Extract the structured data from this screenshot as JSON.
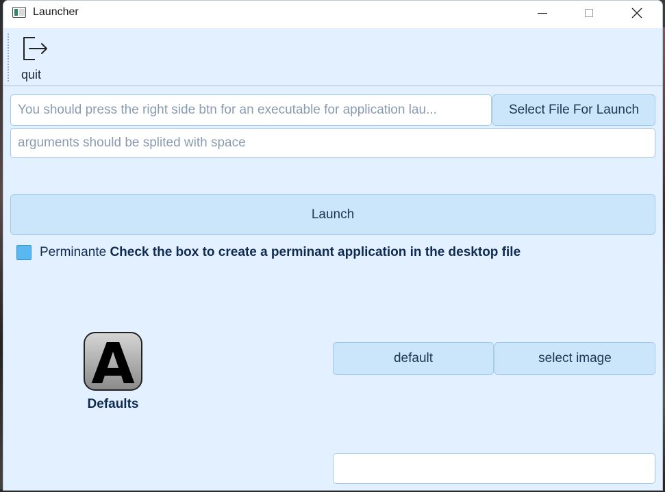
{
  "window": {
    "title": "Launcher"
  },
  "toolbar": {
    "quit_label": "quit"
  },
  "launch_form": {
    "executable_placeholder": "You should press the right side btn for an executable for application lau...",
    "select_file_label": "Select File For Launch",
    "arguments_placeholder": "arguments should be splited with space",
    "launch_label": "Launch"
  },
  "permanent": {
    "checkbox_label": "Perminante",
    "hint": "Check the box to create a perminant application in the desktop file",
    "checked": false
  },
  "icon_section": {
    "icon_letter": "A",
    "icon_caption": "Defaults",
    "default_label": "default",
    "select_image_label": "select image",
    "name_value": ""
  },
  "colors": {
    "window_bg": "#e3f0ff",
    "button_bg": "#cbe5fb",
    "border": "#9cc7f0",
    "accent": "#5ab8f0",
    "text_dark": "#0e2a50"
  }
}
